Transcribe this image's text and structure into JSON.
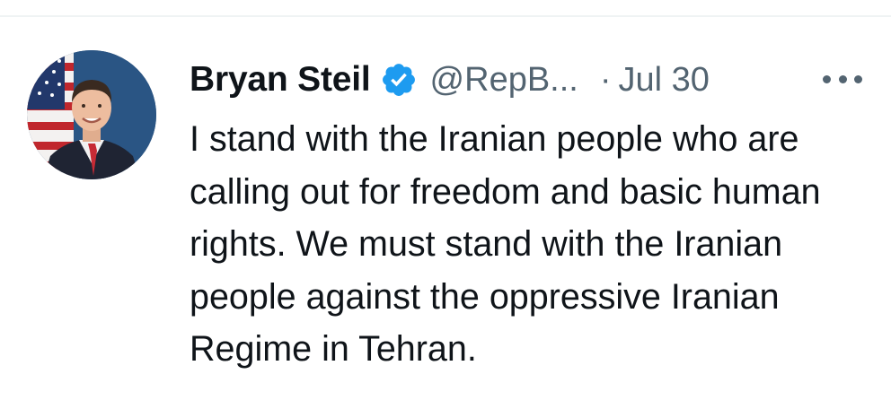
{
  "tweet": {
    "author": {
      "display_name": "Bryan Steil",
      "handle": "@RepB...",
      "verified": true
    },
    "separator": "·",
    "date": "Jul 30",
    "text": "I stand with the Iranian people who are calling out for freedom and basic human rights. We must stand with the Iranian people against the oppressive Iranian Regime in Tehran."
  },
  "icons": {
    "verified": "verified-badge-icon",
    "more": "more-horizontal-icon"
  },
  "colors": {
    "text_primary": "#0f1419",
    "text_secondary": "#536471",
    "verified_blue": "#1d9bf0",
    "divider": "#eff3f4"
  }
}
